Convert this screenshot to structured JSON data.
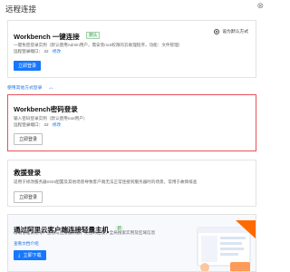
{
  "dialog": {
    "title": "远程连接",
    "close": "⊗"
  },
  "workbench_one_click": {
    "title": "Workbench 一键连接",
    "badge": "默认",
    "default_option": "设为默认方式",
    "desc": "一键免密登录实例（默认使用Admin用户，需安装root权限的云助理程序，功能：文件管理）",
    "port_label": "远程登录端口：",
    "port_value": "22",
    "modify": "修改",
    "button": "立即登录"
  },
  "other_methods_label": "使用其他方式登录",
  "workbench_password": {
    "title": "Workbench密码登录",
    "desc": "输入密码登录实例（默认使用root用户）",
    "port_label": "远程登录端口：",
    "port_value": "22",
    "modify": "修改",
    "button": "立即登录"
  },
  "rescue_login": {
    "title": "救援登录",
    "desc": "适用于修改服务器SSH配置及其他场景导致客户端无法正常连接到服务器时的场景，常用于故障排查",
    "button": "立即登录"
  },
  "promo": {
    "title": "通过阿里云客户端连接轻量主机",
    "badge": "新",
    "desc": "帮助管理云账号、查看与连接服务器，免密码连接，全局搜索实例及区域信息",
    "link": "查看文档介绍",
    "button": "立即下载"
  },
  "colors": {
    "primary": "#1677ff",
    "highlight_border": "#e8515b",
    "link": "#1a73e8",
    "success": "#2b8a3e"
  }
}
